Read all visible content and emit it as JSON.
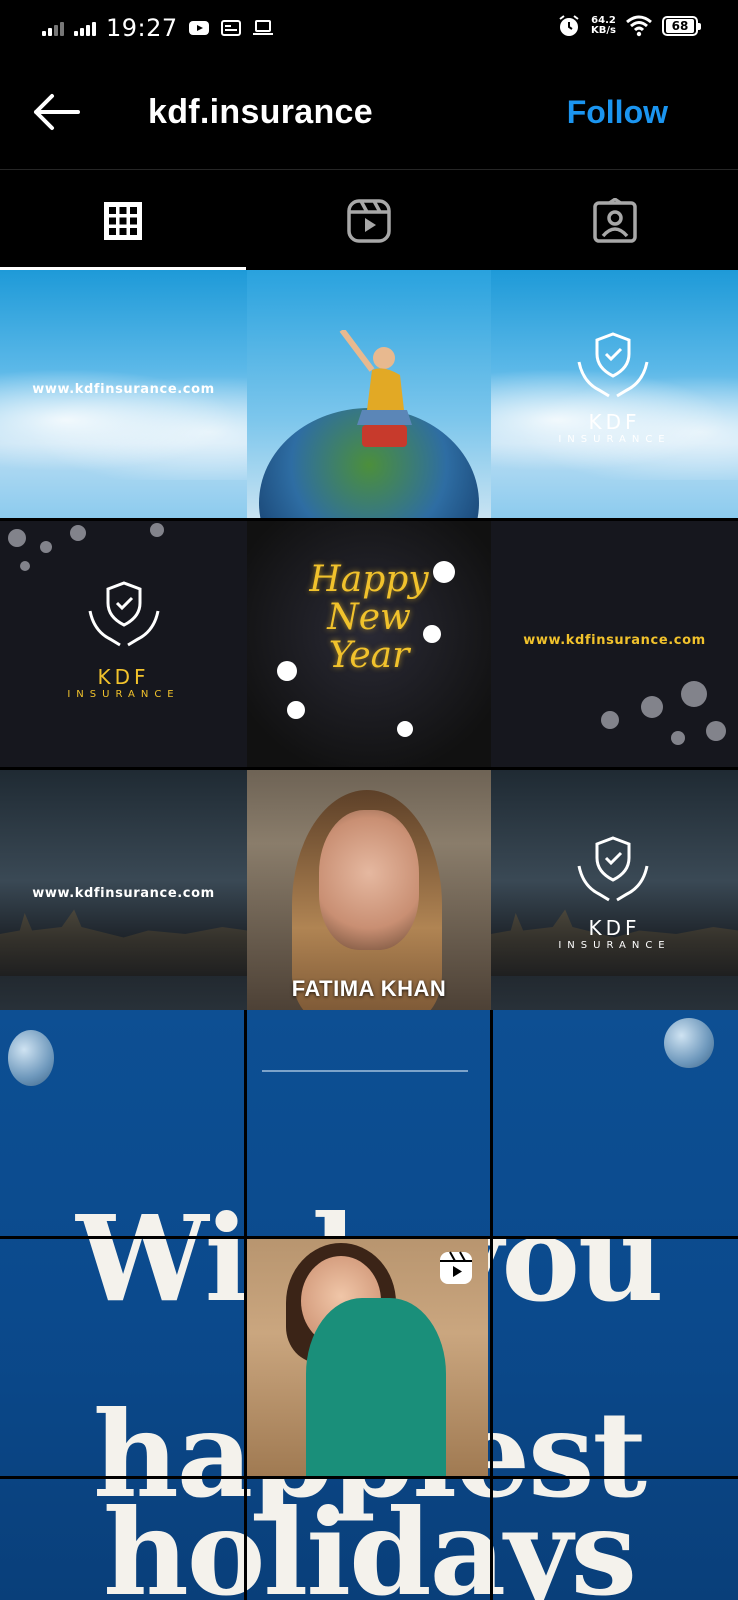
{
  "status_bar": {
    "time": "19:27",
    "network_speed_value": "64.2",
    "network_speed_unit": "KB/s",
    "battery": "68"
  },
  "header": {
    "username": "kdf.insurance",
    "follow_label": "Follow"
  },
  "tabs": [
    {
      "name": "posts-grid",
      "icon": "grid-icon",
      "active": true
    },
    {
      "name": "reels",
      "icon": "reels-icon",
      "active": false
    },
    {
      "name": "tagged",
      "icon": "tagged-person-icon",
      "active": false
    }
  ],
  "posts": {
    "p1_url": "www.kdfinsurance.com",
    "p3_logo": "KDF",
    "p3_logo_sub": "INSURANCE",
    "p4_logo": "KDF",
    "p4_logo_sub": "INSURANCE",
    "p5_text_1": "Happy",
    "p5_text_2": "New",
    "p5_text_3": "Year",
    "p6_url": "www.kdfinsurance.com",
    "p7_url": "www.kdfinsurance.com",
    "p8_name": "FATIMA KHAN",
    "p9_logo": "KDF",
    "p9_logo_sub": "INSURANCE"
  },
  "reel": {
    "line1": "Wish you",
    "line2": "the happiest",
    "line3": "holidays"
  },
  "colors": {
    "follow": "#1b95f0",
    "gold": "#f1c22c",
    "background": "#000000"
  }
}
